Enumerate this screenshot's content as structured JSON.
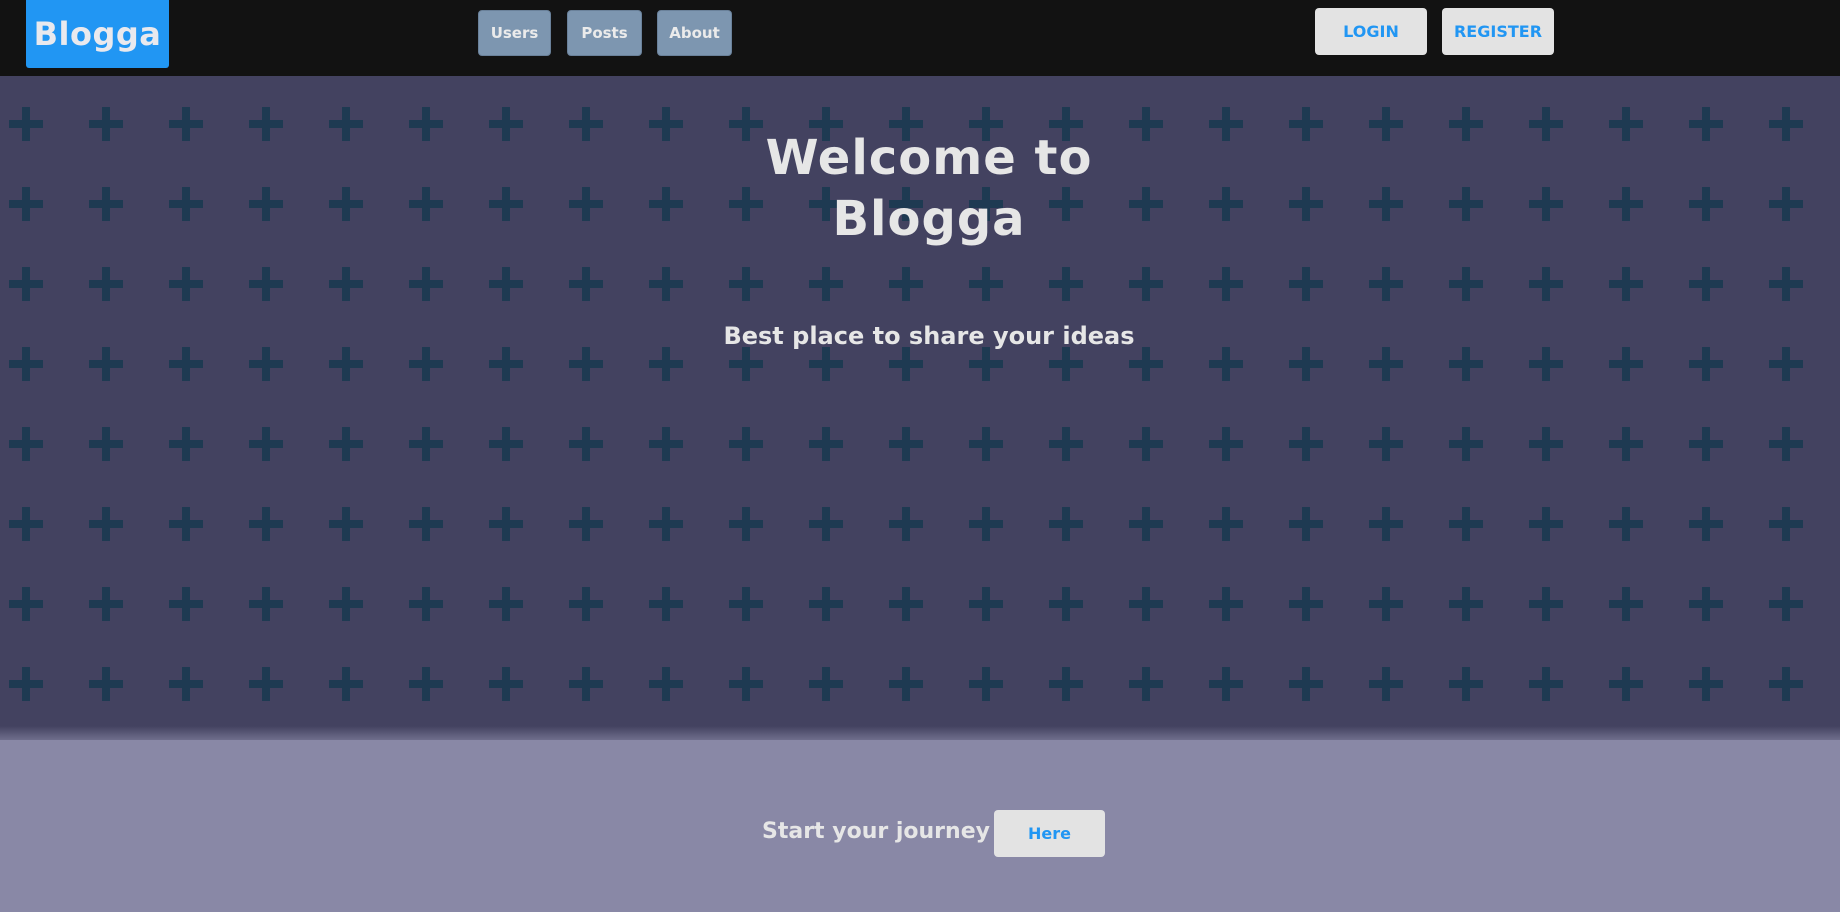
{
  "nav": {
    "logo": "Blogga",
    "links": [
      {
        "label": "Users"
      },
      {
        "label": "Posts"
      },
      {
        "label": "About"
      }
    ],
    "login_label": "LOGIN",
    "register_label": "REGISTER"
  },
  "hero": {
    "title_line1": "Welcome to",
    "title_line2": "Blogga",
    "subtitle": "Best place to share your ideas",
    "pattern_icon": "plus-icon"
  },
  "cta": {
    "text": "Start your journey",
    "button_label": "Here"
  },
  "colors": {
    "brand": "#2196f3",
    "navbar": "#121212",
    "hero_bg": "#434260",
    "pattern": "#1e3a52",
    "footer_bg": "#8988a6",
    "nav_button": "#7d96b0",
    "light_button": "#e3e3e3",
    "text": "#e6e6e6"
  }
}
